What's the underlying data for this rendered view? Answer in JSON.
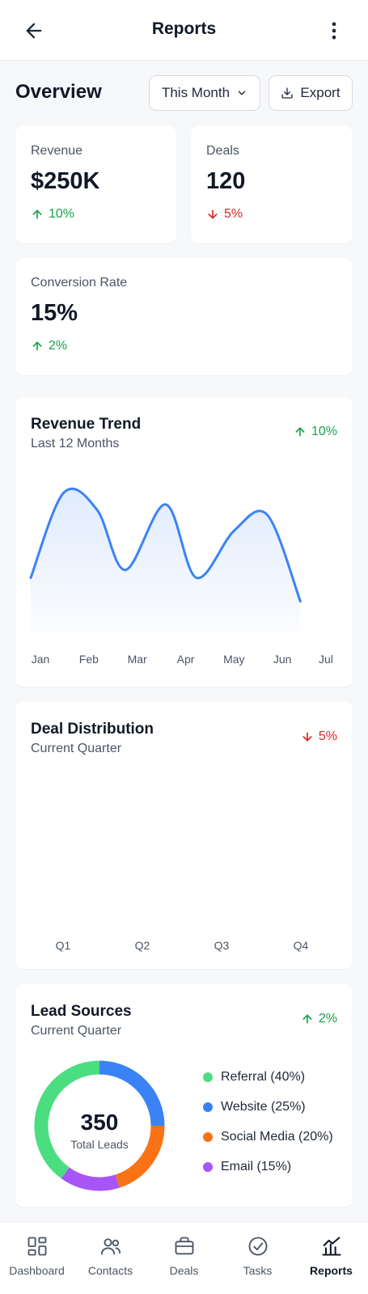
{
  "header": {
    "title": "Reports"
  },
  "overview": {
    "title": "Overview",
    "period_label": "This Month",
    "export_label": "Export"
  },
  "stats": [
    {
      "label": "Revenue",
      "value": "$250K",
      "delta": "10%",
      "direction": "up"
    },
    {
      "label": "Deals",
      "value": "120",
      "delta": "5%",
      "direction": "down"
    },
    {
      "label": "Conversion Rate",
      "value": "15%",
      "delta": "2%",
      "direction": "up"
    }
  ],
  "revenue_trend": {
    "title": "Revenue Trend",
    "subtitle": "Last 12 Months",
    "delta": "10%",
    "direction": "up",
    "line_color": "#3b82f6"
  },
  "deal_distribution": {
    "title": "Deal Distribution",
    "subtitle": "Current Quarter",
    "delta": "5%",
    "direction": "down"
  },
  "lead_sources": {
    "title": "Lead Sources",
    "subtitle": "Current Quarter",
    "delta": "2%",
    "direction": "up",
    "total_value": "350",
    "total_label": "Total Leads",
    "legend": [
      {
        "label": "Referral (40%)",
        "color": "#4ade80"
      },
      {
        "label": "Website (25%)",
        "color": "#3b82f6"
      },
      {
        "label": "Social Media (20%)",
        "color": "#f97316"
      },
      {
        "label": "Email (15%)",
        "color": "#a855f7"
      }
    ]
  },
  "chart_data": [
    {
      "type": "area",
      "title": "Revenue Trend",
      "x": [
        "Jan",
        "Feb",
        "Mar",
        "Apr",
        "May",
        "Jun",
        "Jul"
      ],
      "values": [
        0.3,
        0.95,
        0.82,
        0.36,
        0.86,
        0.3,
        0.66,
        0.78,
        0.12
      ],
      "value_positions": [
        0,
        0.7,
        1.4,
        2.0,
        2.85,
        3.5,
        4.3,
        5.0,
        5.7
      ],
      "xlabel": "",
      "ylabel": ""
    },
    {
      "type": "bar",
      "title": "Deal Distribution",
      "categories": [
        "Q1",
        "Q2",
        "Q3",
        "Q4"
      ],
      "values": []
    },
    {
      "type": "pie",
      "title": "Lead Sources",
      "categories": [
        "Referral",
        "Website",
        "Social Media",
        "Email"
      ],
      "values": [
        40,
        25,
        20,
        15
      ],
      "colors": [
        "#4ade80",
        "#3b82f6",
        "#f97316",
        "#a855f7"
      ]
    }
  ],
  "tabs": [
    {
      "label": "Dashboard",
      "icon": "dashboard-icon",
      "active": false
    },
    {
      "label": "Contacts",
      "icon": "contacts-icon",
      "active": false
    },
    {
      "label": "Deals",
      "icon": "briefcase-icon",
      "active": false
    },
    {
      "label": "Tasks",
      "icon": "check-circle-icon",
      "active": false
    },
    {
      "label": "Reports",
      "icon": "chart-icon",
      "active": true
    }
  ]
}
